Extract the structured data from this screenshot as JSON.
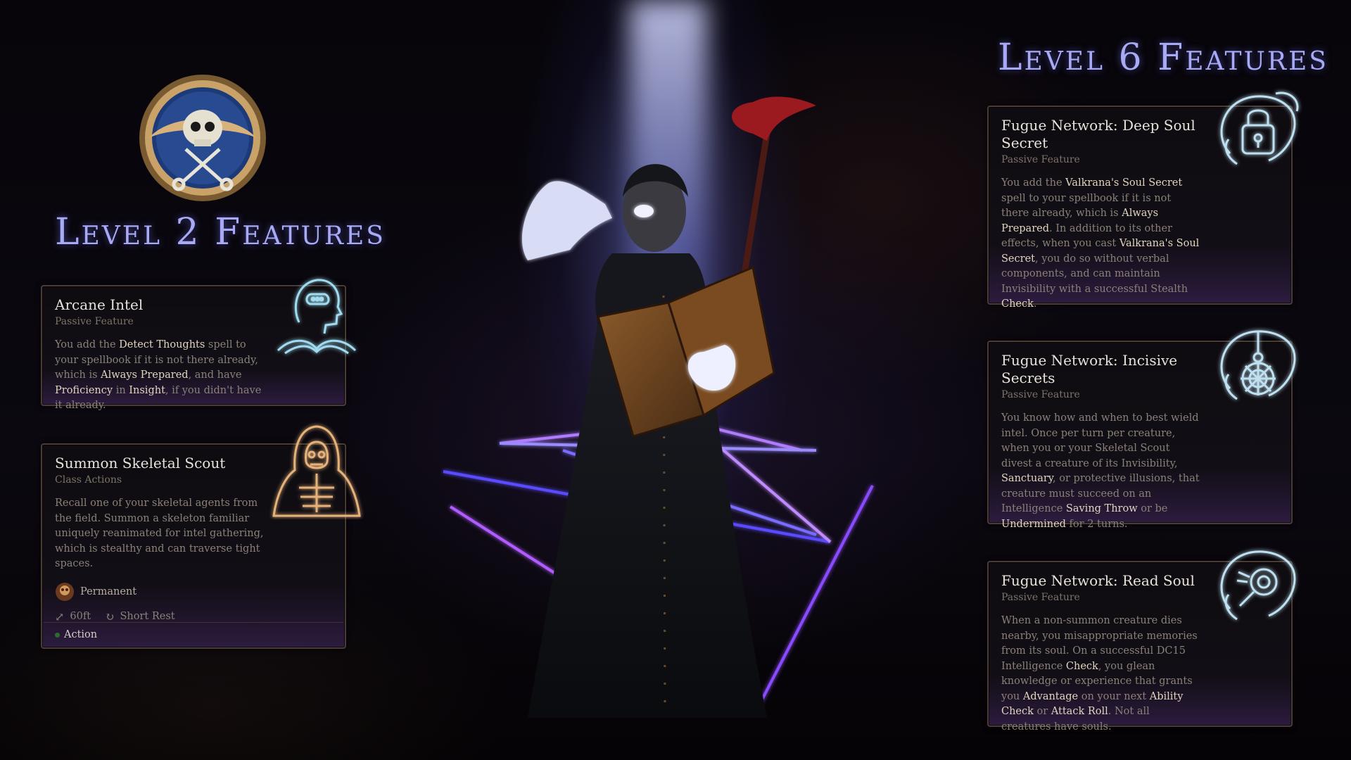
{
  "left": {
    "heading": "Level 2 Features",
    "features": [
      {
        "title": "Arcane Intel",
        "subtitle": "Passive Feature",
        "icon": "head-with-book-icon",
        "desc": [
          {
            "t": "You add the "
          },
          {
            "t": "Detect Thoughts",
            "k": true
          },
          {
            "t": " spell to your spellbook if it is not there already, which is "
          },
          {
            "t": "Always Prepared",
            "k": true
          },
          {
            "t": ", and have "
          },
          {
            "t": "Proficiency",
            "k": true
          },
          {
            "t": " in "
          },
          {
            "t": "Insight",
            "k": true
          },
          {
            "t": ", if you didn't have it already."
          }
        ]
      },
      {
        "title": "Summon Skeletal Scout",
        "subtitle": "Class Actions",
        "icon": "hooded-skeleton-icon",
        "desc": [
          {
            "t": "Recall one of your skeletal agents from the field. Summon a skeleton familiar uniquely reanimated for intel gathering, which is stealthy and can traverse tight spaces."
          }
        ],
        "duration": "Permanent",
        "range": "60ft",
        "recharge": "Short Rest",
        "cost": "Action"
      }
    ]
  },
  "right": {
    "heading": "Level 6 Features",
    "features": [
      {
        "title": "Fugue Network: Deep Soul Secret",
        "subtitle": "Passive Feature",
        "icon": "padlock-swirl-icon",
        "desc": [
          {
            "t": "You add the "
          },
          {
            "t": "Valkrana's Soul Secret",
            "k": true
          },
          {
            "t": " spell to your spellbook if it is not there already, which is "
          },
          {
            "t": "Always Prepared",
            "k": true
          },
          {
            "t": ". In addition to its other effects, when you cast "
          },
          {
            "t": "Valkrana's Soul Secret",
            "k": true
          },
          {
            "t": ", you do so without verbal components, and can maintain Invisibility with a successful Stealth "
          },
          {
            "t": "Check",
            "k": true
          },
          {
            "t": "."
          }
        ]
      },
      {
        "title": "Fugue Network: Incisive Secrets",
        "subtitle": "Passive Feature",
        "icon": "spiderweb-swirl-icon",
        "desc": [
          {
            "t": "You know how and when to best wield intel. Once per turn per creature, when you or your Skeletal Scout divest a creature of its Invisibility, "
          },
          {
            "t": "Sanctuary",
            "k": true
          },
          {
            "t": ", or protective illusions, that creature must succeed on an Intelligence "
          },
          {
            "t": "Saving Throw",
            "k": true
          },
          {
            "t": " or be "
          },
          {
            "t": "Undermined",
            "k": true
          },
          {
            "t": " for 2 turns."
          }
        ]
      },
      {
        "title": "Fugue Network: Read Soul",
        "subtitle": "Passive Feature",
        "icon": "magnifier-swirl-icon",
        "desc": [
          {
            "t": "When a non-summon creature dies nearby, you misappropriate memories from its soul. On a successful DC15 Intelligence "
          },
          {
            "t": "Check",
            "k": true
          },
          {
            "t": ", you glean knowledge or experience that grants you "
          },
          {
            "t": "Advantage",
            "k": true
          },
          {
            "t": " on your next "
          },
          {
            "t": "Ability Check",
            "k": true
          },
          {
            "t": " or "
          },
          {
            "t": "Attack Roll",
            "k": true
          },
          {
            "t": ". Not all creatures have souls."
          }
        ]
      }
    ]
  },
  "emblem": {
    "icon": "skull-crossed-keys-emblem"
  },
  "colors": {
    "heading": "#a9aaf6",
    "keyword": "#e2d6be",
    "body": "#8a8177",
    "card_border": "#4a3c35",
    "action_dot": "#2f6a2f"
  }
}
